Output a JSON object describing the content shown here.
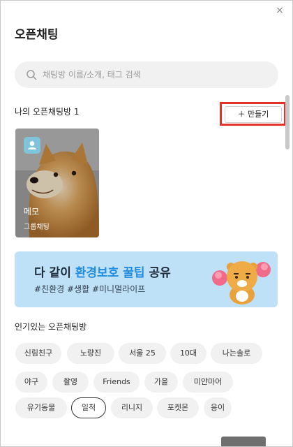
{
  "window": {
    "close_glyph": "×"
  },
  "title": "오픈채팅",
  "search": {
    "placeholder": "채팅방 이름/소개, 태그 검색",
    "icon": "search-icon"
  },
  "my_rooms": {
    "label": "나의 오픈채팅방 1",
    "create_label": "＋ 만들기",
    "rooms": [
      {
        "name": "메모",
        "type": "그룹채팅",
        "badge_icon": "person-icon"
      }
    ]
  },
  "banner": {
    "line1_prefix": "다 같이 ",
    "line1_highlight": "환경보호 꿀팁",
    "line1_suffix": " 공유",
    "line2": "#친환경 #생활 #미니멀라이프",
    "colors": {
      "background": "#bfe1f7",
      "highlight": "#1f8ce0"
    }
  },
  "popular": {
    "label": "인기있는 오픈채팅방",
    "tags": [
      {
        "label": "신림친구",
        "active": false
      },
      {
        "label": "노량진",
        "active": false
      },
      {
        "label": "서울 25",
        "active": false
      },
      {
        "label": "10대",
        "active": false
      },
      {
        "label": "나는솔로",
        "active": false
      },
      {
        "label": "야구",
        "active": false
      },
      {
        "label": "촬영",
        "active": false
      },
      {
        "label": "Friends",
        "active": false
      },
      {
        "label": "가을",
        "active": false
      },
      {
        "label": "미얀마어",
        "active": false
      },
      {
        "label": "유기동물",
        "active": false
      },
      {
        "label": "일척",
        "active": true
      },
      {
        "label": "리니지",
        "active": false
      },
      {
        "label": "포켓몬",
        "active": false
      },
      {
        "label": "응이",
        "active": false
      }
    ]
  },
  "colors": {
    "highlight_box": "#e8302a",
    "chip_bg": "#f1f1f1"
  }
}
